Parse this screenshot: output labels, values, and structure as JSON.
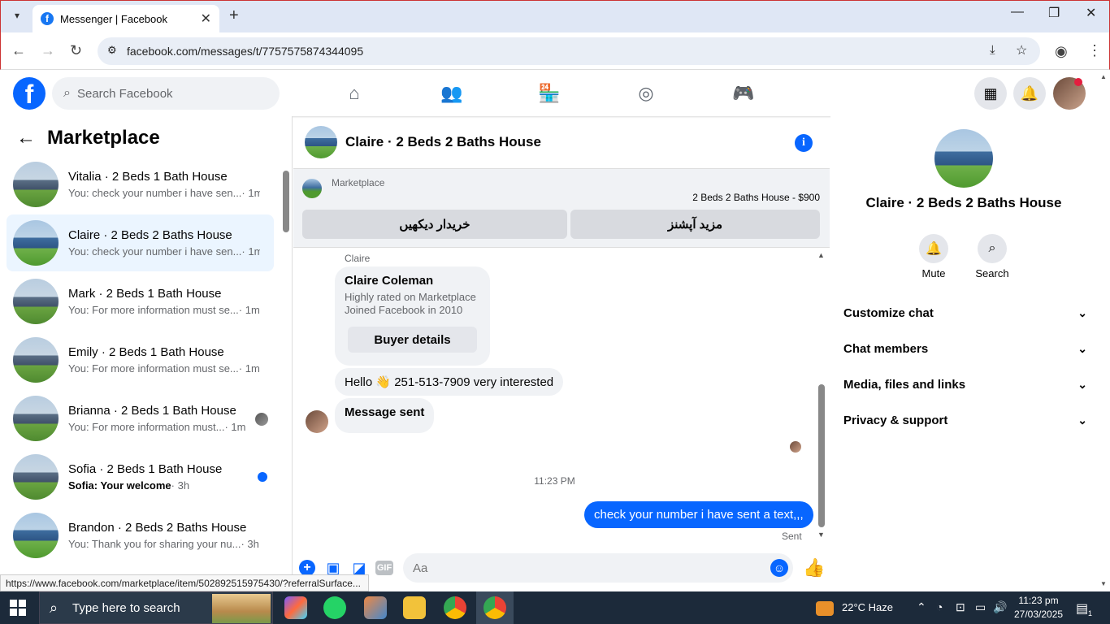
{
  "browser": {
    "tab_title": "Messenger | Facebook",
    "url": "facebook.com/messages/t/7757575874344095",
    "status_url": "https://www.facebook.com/marketplace/item/502892515975430/?referralSurface..."
  },
  "fb": {
    "search_placeholder": "Search Facebook"
  },
  "sidebar": {
    "title": "Marketplace",
    "conversations": [
      {
        "name": "Vitalia · 2 Beds 1 Bath House",
        "preview": "You: check your number i have sen...",
        "time": "· 1m"
      },
      {
        "name": "Claire · 2 Beds 2 Baths House",
        "preview": "You: check your number i have sen...",
        "time": "· 1m"
      },
      {
        "name": "Mark · 2 Beds 1 Bath House",
        "preview": "You: For more information must se...",
        "time": "· 1m"
      },
      {
        "name": "Emily · 2 Beds 1 Bath House",
        "preview": "You: For more information must se...",
        "time": "· 1m"
      },
      {
        "name": "Brianna · 2 Beds 1 Bath House",
        "preview": "You: For more information must...",
        "time": "· 1m"
      },
      {
        "name": "Sofia · 2 Beds 1 Bath House",
        "preview": "Sofia: Your welcome",
        "time": "· 3h"
      },
      {
        "name": "Brandon · 2 Beds 2 Baths House",
        "preview": "You: Thank you for sharing your nu...",
        "time": "· 3h"
      }
    ]
  },
  "chat": {
    "title": "Claire · 2 Beds 2 Baths House",
    "marketplace_label": "Marketplace",
    "listing": "2 Beds 2 Baths House - $900",
    "btn_see_buyer": "خریدار دیکھیں",
    "btn_more_options": "مزید آپشنز",
    "sender_label": "Claire",
    "card_name": "Claire Coleman",
    "card_line1": "Highly rated on Marketplace",
    "card_line2": "Joined Facebook in 2010",
    "buyer_details": "Buyer details",
    "msg1": "Hello 👋 251-513-7909 very interested",
    "msg2": "Message sent",
    "timestamp": "11:23 PM",
    "outgoing": "check your number i have sent a text,,,",
    "sent_label": "Sent",
    "input_placeholder": "Aa"
  },
  "right": {
    "name": "Claire · 2 Beds 2 Baths House",
    "mute": "Mute",
    "search": "Search",
    "rows": [
      "Customize chat",
      "Chat members",
      "Media, files and links",
      "Privacy & support"
    ]
  },
  "taskbar": {
    "search": "Type here to search",
    "weather": "22°C  Haze",
    "time": "11:23 pm",
    "date": "27/03/2025",
    "notif_count": "1"
  }
}
